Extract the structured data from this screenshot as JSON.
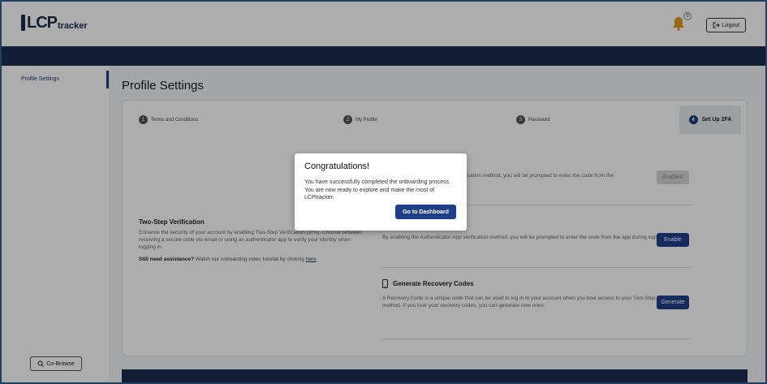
{
  "app": {
    "logo_main": "LCP",
    "logo_sub": "tracker",
    "notification_count": "0",
    "logout_label": "Logout"
  },
  "sidebar": {
    "items": [
      {
        "label": "Profile Settings"
      }
    ],
    "cobrowse_label": "Co-Browse"
  },
  "main": {
    "title": "Profile Settings",
    "steps": [
      {
        "num": "1",
        "label": "Terms and Conditions"
      },
      {
        "num": "2",
        "label": "My Profile"
      },
      {
        "num": "3",
        "label": "Password"
      },
      {
        "num": "4",
        "label": "Set Up 2FA"
      }
    ],
    "two_step": {
      "title": "Two-Step Verification",
      "body": "Enhance the security of your account by enabling Two-Step Verification (2FA). Choose between receiving a secure code via email or using an authenticator app to verify your identity when logging in.",
      "assist_bold": "Still need assistance?",
      "assist_text": " Watch our onboarding video tutorial by clicking ",
      "assist_link": "here"
    },
    "options": {
      "email_text_fragment": "ification method, you will be prompted to enter the code from the",
      "email_button": "Enabled",
      "auth_text": "By enabling the Authenticator App verification method, you will be prompted to enter the code from the app during login.",
      "auth_button": "Enable",
      "recovery_title": "Generate Recovery Codes",
      "recovery_text": "A Recovery Code is a unique code that can be used to log in to your account when you lose access to your Two-Step Verification method. If you lose your recovery codes, you can generate new ones.",
      "recovery_button": "Generate"
    }
  },
  "modal": {
    "title": "Congratulations!",
    "body": "You have successfully completed the onboarding process. You are now ready to explore and make the most of LCPtracker.",
    "button": "Go to Dashboard"
  },
  "colors": {
    "navy": "#1d2b4f",
    "primary_button": "#1f3f8a",
    "bell": "#e09a1a",
    "frame_border": "#2d5f8f"
  }
}
